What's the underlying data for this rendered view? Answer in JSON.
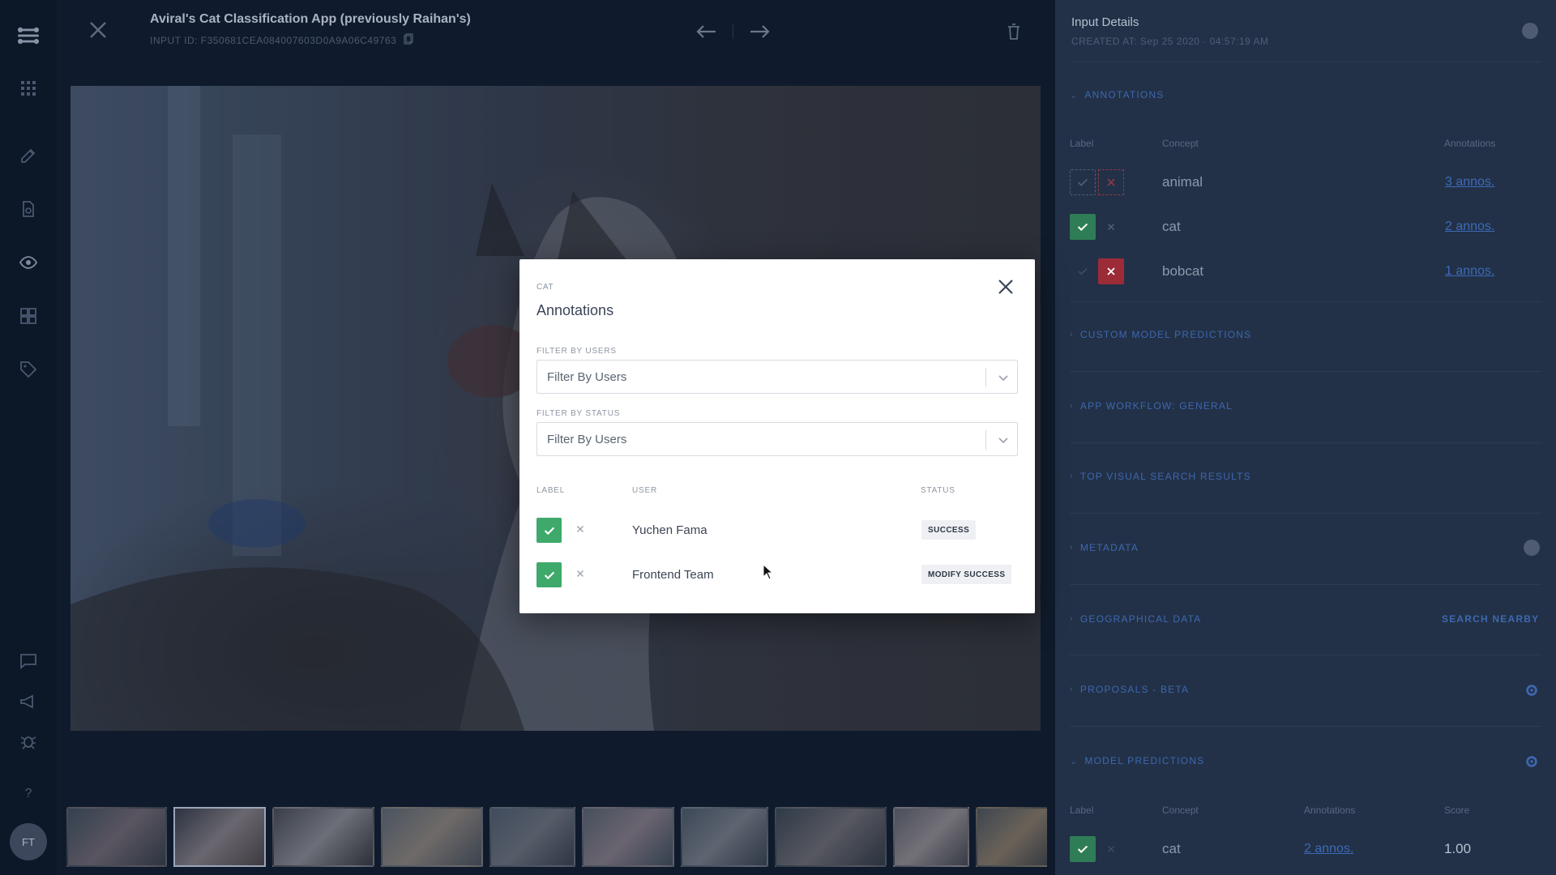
{
  "app": {
    "title": "Aviral's Cat Classification App (previously Raihan's)",
    "input_id": "INPUT ID: F350681CEA084007603D0A9A06C49763"
  },
  "rail": {
    "avatar_initials": "FT",
    "icons": [
      "logo-icon",
      "apps-grid-icon",
      "edit-icon",
      "file-search-icon",
      "eye-icon",
      "dashboard-icon",
      "tag-icon",
      "chat-icon",
      "megaphone-icon",
      "bug-icon",
      "help-icon"
    ]
  },
  "right_panel": {
    "title": "Input Details",
    "created": "CREATED AT: Sep 25 2020 · 04:57:19 AM",
    "annotations_section": "ANNOTATIONS",
    "columns": {
      "label": "Label",
      "concept": "Concept",
      "annotations": "Annotations",
      "score": "Score"
    },
    "annotation_rows": [
      {
        "concept": "animal",
        "annos": "3 annos."
      },
      {
        "concept": "cat",
        "annos": "2 annos."
      },
      {
        "concept": "bobcat",
        "annos": "1 annos."
      }
    ],
    "sections": {
      "custom_model": "CUSTOM MODEL PREDICTIONS",
      "app_workflow": "APP WORKFLOW: GENERAL",
      "top_visual": "TOP VISUAL SEARCH RESULTS",
      "metadata": "METADATA",
      "geo": "GEOGRAPHICAL DATA",
      "proposals": "PROPOSALS - BETA",
      "model_predictions": "MODEL PREDICTIONS"
    },
    "search_nearby": "SEARCH NEARBY",
    "prediction_row": {
      "concept": "cat",
      "annos": "2 annos.",
      "score": "1.00"
    }
  },
  "modal": {
    "concept": "CAT",
    "title": "Annotations",
    "filter_users_label": "FILTER BY USERS",
    "filter_users_placeholder": "Filter By Users",
    "filter_status_label": "FILTER BY STATUS",
    "filter_status_placeholder": "Filter By Users",
    "columns": {
      "label": "LABEL",
      "user": "USER",
      "status": "STATUS"
    },
    "rows": [
      {
        "user": "Yuchen Fama",
        "status": "SUCCESS"
      },
      {
        "user": "Frontend Team",
        "status": "MODIFY SUCCESS"
      }
    ]
  },
  "colors": {
    "accent_link": "#3d6ab8",
    "positive": "#3ea96b",
    "negative": "#d0343f"
  }
}
